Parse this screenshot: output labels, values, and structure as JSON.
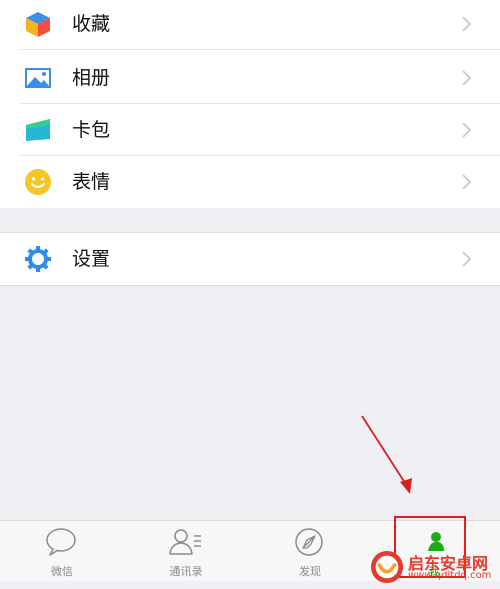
{
  "menu_group_1": [
    {
      "label": "收藏",
      "icon": "favorites-cube-icon"
    },
    {
      "label": "相册",
      "icon": "album-picture-icon"
    },
    {
      "label": "卡包",
      "icon": "card-wallet-icon"
    },
    {
      "label": "表情",
      "icon": "sticker-smiley-icon"
    }
  ],
  "menu_group_2": [
    {
      "label": "设置",
      "icon": "settings-gear-icon"
    }
  ],
  "tabbar": {
    "tabs": [
      {
        "label": "微信",
        "icon": "chat-bubble-icon"
      },
      {
        "label": "通讯录",
        "icon": "contacts-icon"
      },
      {
        "label": "发现",
        "icon": "compass-icon"
      },
      {
        "label": "我",
        "icon": "me-person-icon"
      }
    ]
  },
  "watermark": {
    "title": "启东安卓网",
    "url": "www.qdltdq.com"
  },
  "colors": {
    "accent_green": "#1aad19",
    "highlight_red": "#e0201f",
    "watermark_red": "#e63a2e"
  }
}
